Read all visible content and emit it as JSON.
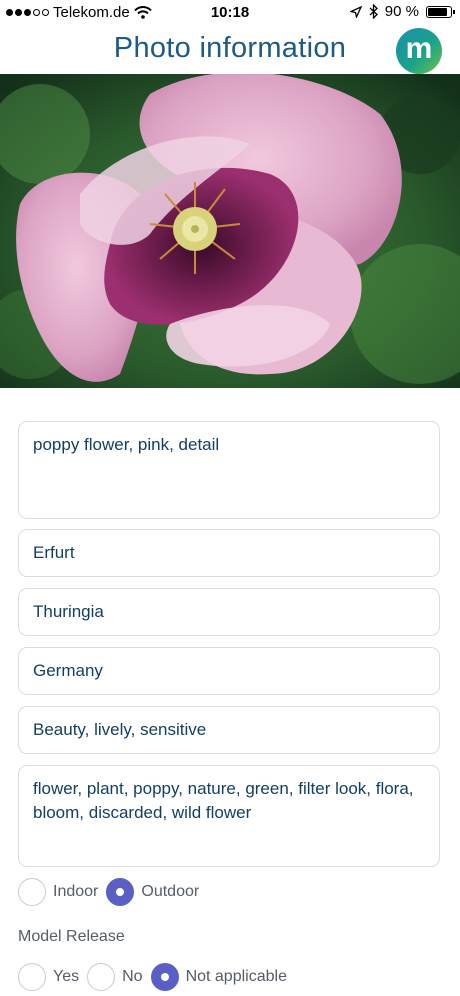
{
  "status_bar": {
    "carrier": "Telekom.de",
    "time": "10:18",
    "battery": "90 %",
    "battery_level": 0.9,
    "icons": [
      "signal-icon",
      "wifi-icon",
      "location-icon",
      "bluetooth-icon",
      "battery-icon"
    ]
  },
  "header": {
    "title": "Photo information",
    "logo_letter": "m"
  },
  "form": {
    "title_value": "poppy flower, pink, detail",
    "city_value": "Erfurt",
    "region_value": "Thuringia",
    "country_value": "Germany",
    "description_value": "Beauty, lively, sensitive",
    "keywords_value": "flower, plant, poppy, nature, green, filter look, flora, bloom, discarded, wild flower"
  },
  "location_type": {
    "options": [
      "Indoor",
      "Outdoor"
    ],
    "selected": "Outdoor"
  },
  "model_release": {
    "label": "Model Release",
    "options": [
      "Yes",
      "No",
      "Not applicable"
    ],
    "selected": "Not applicable"
  },
  "colors": {
    "title": "#1c5a8a",
    "field_text": "#123f66",
    "radio_selected": "#5a5fc6"
  }
}
